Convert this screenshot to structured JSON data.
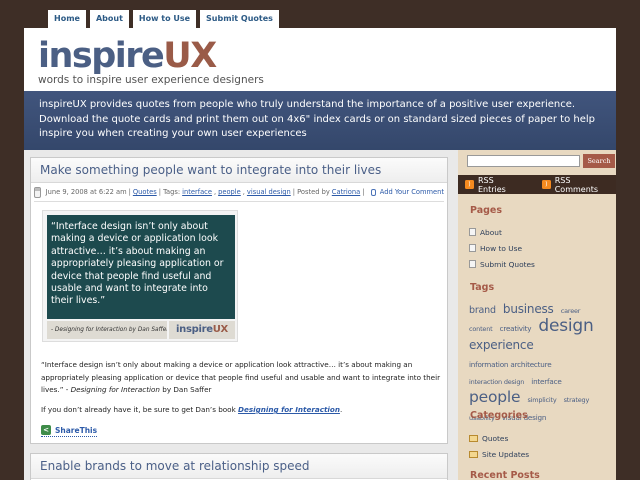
{
  "nav": {
    "items": [
      {
        "label": "Home"
      },
      {
        "label": "About"
      },
      {
        "label": "How to Use"
      },
      {
        "label": "Submit Quotes"
      }
    ]
  },
  "header": {
    "logo_part1": "inspire",
    "logo_part2": "UX",
    "tagline": "words to inspire user experience designers"
  },
  "banner": {
    "text": "inspireUX provides quotes from people who truly understand the importance of a positive user experience.  Download the quote cards and print them out on 4x6\" index cards or on standard sized pieces of paper to help inspire you when creating your own user experiences"
  },
  "post1": {
    "title": "Make something people want to integrate into their lives",
    "date": "June 9, 2008 at 6:22 am",
    "sep1": "|",
    "category": "Quotes",
    "tags_label": "| Tags:",
    "tags": [
      "interface",
      "people",
      "visual design"
    ],
    "posted_by_label": "| Posted by",
    "author": "Catriona",
    "sep2": "|",
    "add_comment": "Add Your Comment",
    "card_quote": "“Interface design isn’t only about making a device or application look attractive… it’s about making an appropriately pleasing application or device that people find useful and usable and want to integrate into their lives.”",
    "card_author": "- Designing for Interaction by Dan Saffer",
    "card_logo_part1": "inspire",
    "card_logo_part2": "UX",
    "quote_text": "“Interface design isn’t only about making a device or application look attractive… it’s about making an appropriately pleasing application or device that people find useful and usable and want to integrate into their lives.” -",
    "quote_source": "Designing for Interaction",
    "quote_by": "by Dan Saffer",
    "followup_text": "If you don’t already have it, be sure to get Dan’s book",
    "followup_link": "Designing for Interaction",
    "followup_end": ".",
    "share_label": "ShareThis"
  },
  "post2": {
    "title": "Enable brands to move at relationship speed"
  },
  "sidebar": {
    "search_placeholder": "",
    "search_button": "Search",
    "rss_entries": "RSS Entries",
    "rss_comments": "RSS Comments",
    "pages_heading": "Pages",
    "pages": [
      "About",
      "How to Use",
      "Submit Quotes"
    ],
    "tags_heading": "Tags",
    "tags": [
      {
        "label": "brand",
        "size": "t-m"
      },
      {
        "label": "business",
        "size": "t-l"
      },
      {
        "label": "career",
        "size": "t-xs"
      },
      {
        "label": "content",
        "size": "t-xs"
      },
      {
        "label": "creativity",
        "size": "t-s"
      },
      {
        "label": "design",
        "size": "t-xxl"
      },
      {
        "label": "experience",
        "size": "t-l"
      },
      {
        "label": "information architecture",
        "size": "t-s"
      },
      {
        "label": "interaction design",
        "size": "t-xs"
      },
      {
        "label": "interface",
        "size": "t-s"
      },
      {
        "label": "people",
        "size": "t-xl"
      },
      {
        "label": "simplicity",
        "size": "t-xs"
      },
      {
        "label": "strategy",
        "size": "t-xs"
      },
      {
        "label": "usability",
        "size": "t-xs"
      },
      {
        "label": "visual design",
        "size": "t-s"
      }
    ],
    "categories_heading": "Categories",
    "categories": [
      "Quotes",
      "Site Updates"
    ],
    "recent_heading": "Recent Posts"
  },
  "colors": {
    "background": "#3e2e26",
    "brand_blue": "#4b5f84",
    "brand_rust": "#9a5b48",
    "banner": "#3b4e74",
    "sidebar": "#e8d9c1",
    "card_green": "#1d4a4e"
  }
}
